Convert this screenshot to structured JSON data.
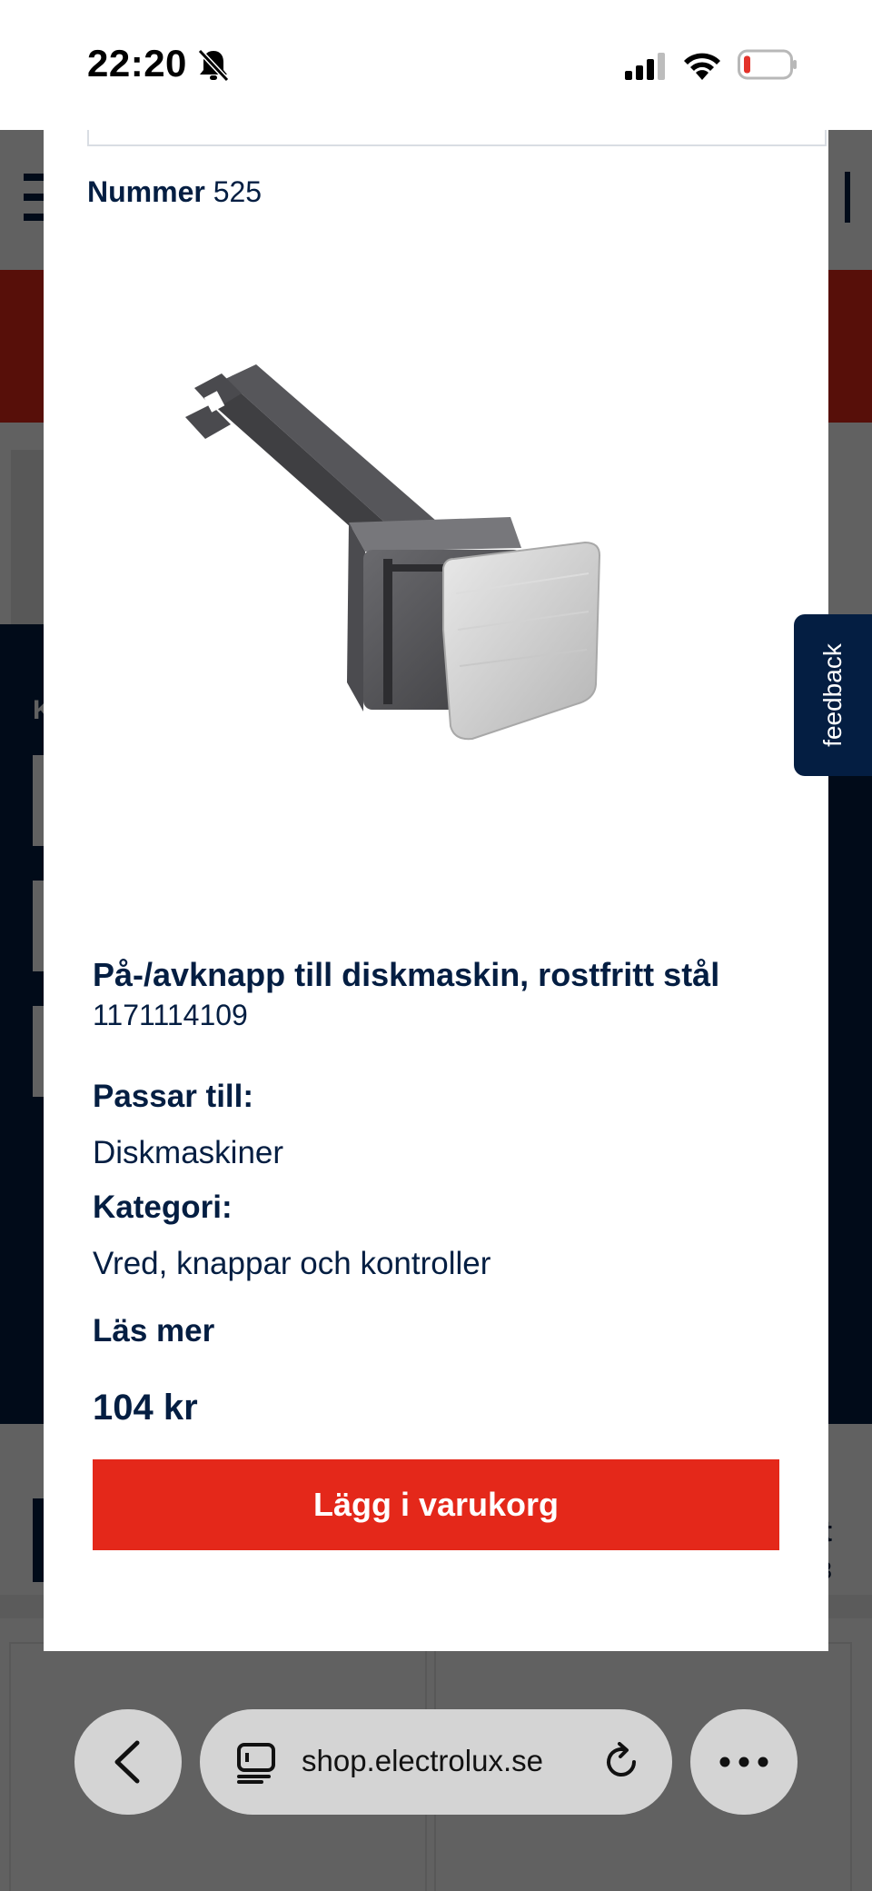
{
  "status_bar": {
    "time": "22:20"
  },
  "background_page": {
    "partial_heading_letter": "K",
    "partial_right_title": "t",
    "partial_right_sub": "3"
  },
  "modal": {
    "number_label": "Nummer",
    "number_value": "525",
    "product_title": "På-/avknapp till diskmaskin, rostfritt stål",
    "product_sku": "1171114109",
    "fits_label": "Passar till:",
    "fits_value": "Diskmaskiner",
    "category_label": "Kategori:",
    "category_value": "Vred, knappar och kontroller",
    "read_more": "Läs mer",
    "price": "104 kr",
    "add_to_cart": "Lägg i varukorg"
  },
  "feedback_tab": {
    "label": "feedback"
  },
  "browser": {
    "url": "shop.electrolux.se"
  },
  "colors": {
    "brand_navy": "#041e42",
    "brand_red": "#e4281a"
  },
  "icons": [
    "bell-muted-icon",
    "signal-icon",
    "wifi-icon",
    "battery-low-icon",
    "back-icon",
    "tabs-icon",
    "reload-icon",
    "more-icon"
  ]
}
